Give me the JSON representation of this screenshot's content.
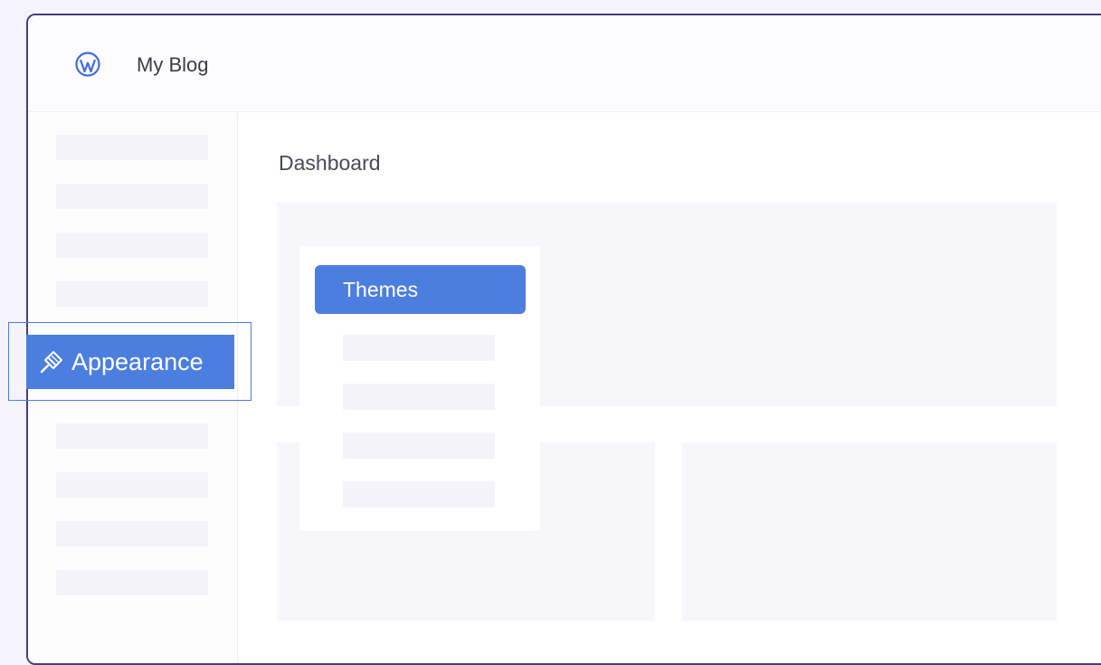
{
  "header": {
    "site_title": "My Blog",
    "logo_icon": "wordpress-logo-icon"
  },
  "main": {
    "title": "Dashboard"
  },
  "sidebar": {
    "highlighted_item": {
      "label": "Appearance",
      "icon": "paintbrush-icon"
    }
  },
  "flyout": {
    "active_item": "Themes"
  },
  "colors": {
    "accent": "#4c7ee0",
    "window_border": "#4b3a86",
    "placeholder": "#f4f3fa",
    "background": "#f5f3fc"
  }
}
